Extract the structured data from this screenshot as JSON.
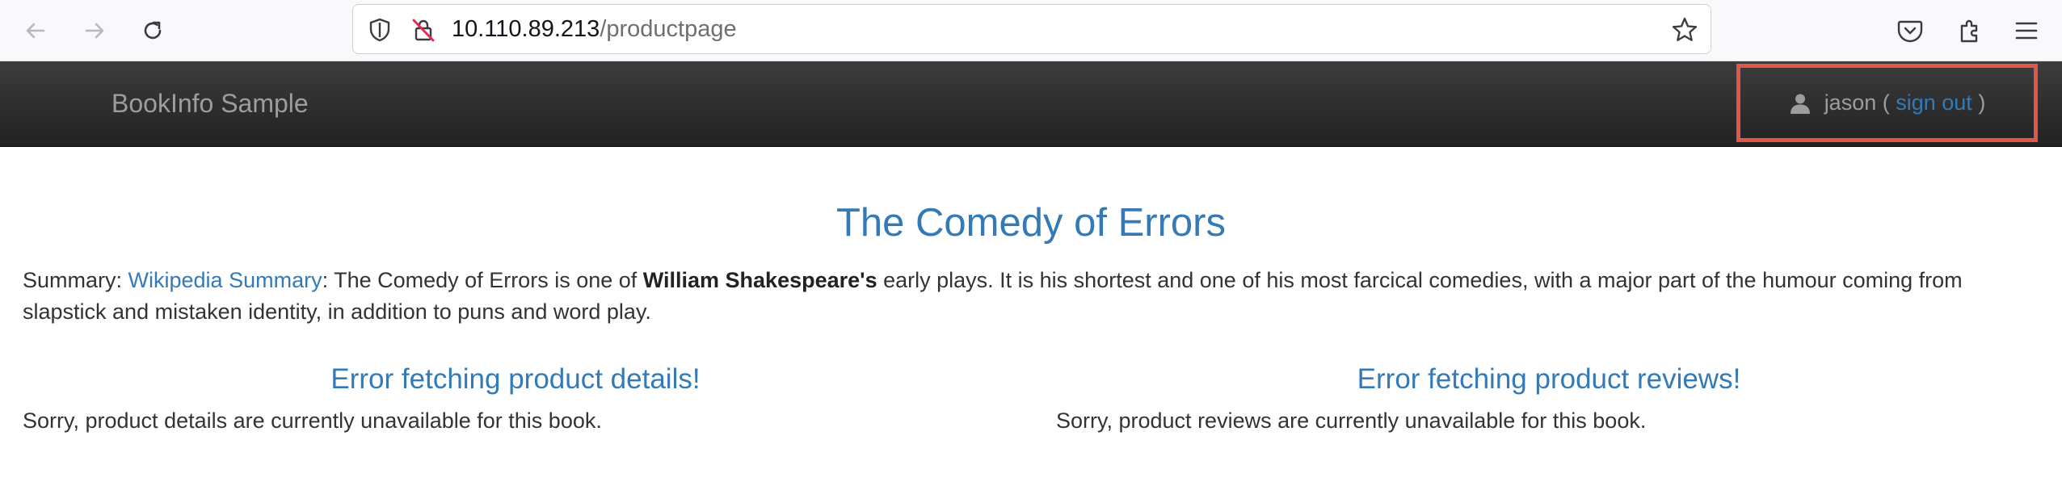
{
  "browser": {
    "url_host": "10.110.89.213",
    "url_path": "/productpage",
    "icons": [
      "back-arrow-icon",
      "forward-arrow-icon",
      "reload-icon",
      "shield-icon",
      "insecure-lock-icon",
      "bookmark-star-icon",
      "pocket-icon",
      "extensions-icon",
      "hamburger-menu-icon"
    ]
  },
  "navbar": {
    "brand": "BookInfo Sample",
    "user": "jason",
    "open_paren": " ( ",
    "sign_out": "sign out",
    "close_paren": " )",
    "highlight_color": "#e0574a"
  },
  "book": {
    "title": "The Comedy of Errors",
    "summary_label": "Summary: ",
    "summary_link": "Wikipedia Summary",
    "summary_text_1": ": The Comedy of Errors is one of ",
    "summary_bold": "William Shakespeare's",
    "summary_text_2": " early plays. It is his shortest and one of his most farcical comedies, with a major part of the humour coming from slapstick and mistaken identity, in addition to puns and word play."
  },
  "details": {
    "heading": "Error fetching product details!",
    "message": "Sorry, product details are currently unavailable for this book."
  },
  "reviews": {
    "heading": "Error fetching product reviews!",
    "message": "Sorry, product reviews are currently unavailable for this book."
  },
  "colors": {
    "link": "#337ab7",
    "navbar_bg": "#222222",
    "navbar_text": "#9d9d9d"
  }
}
